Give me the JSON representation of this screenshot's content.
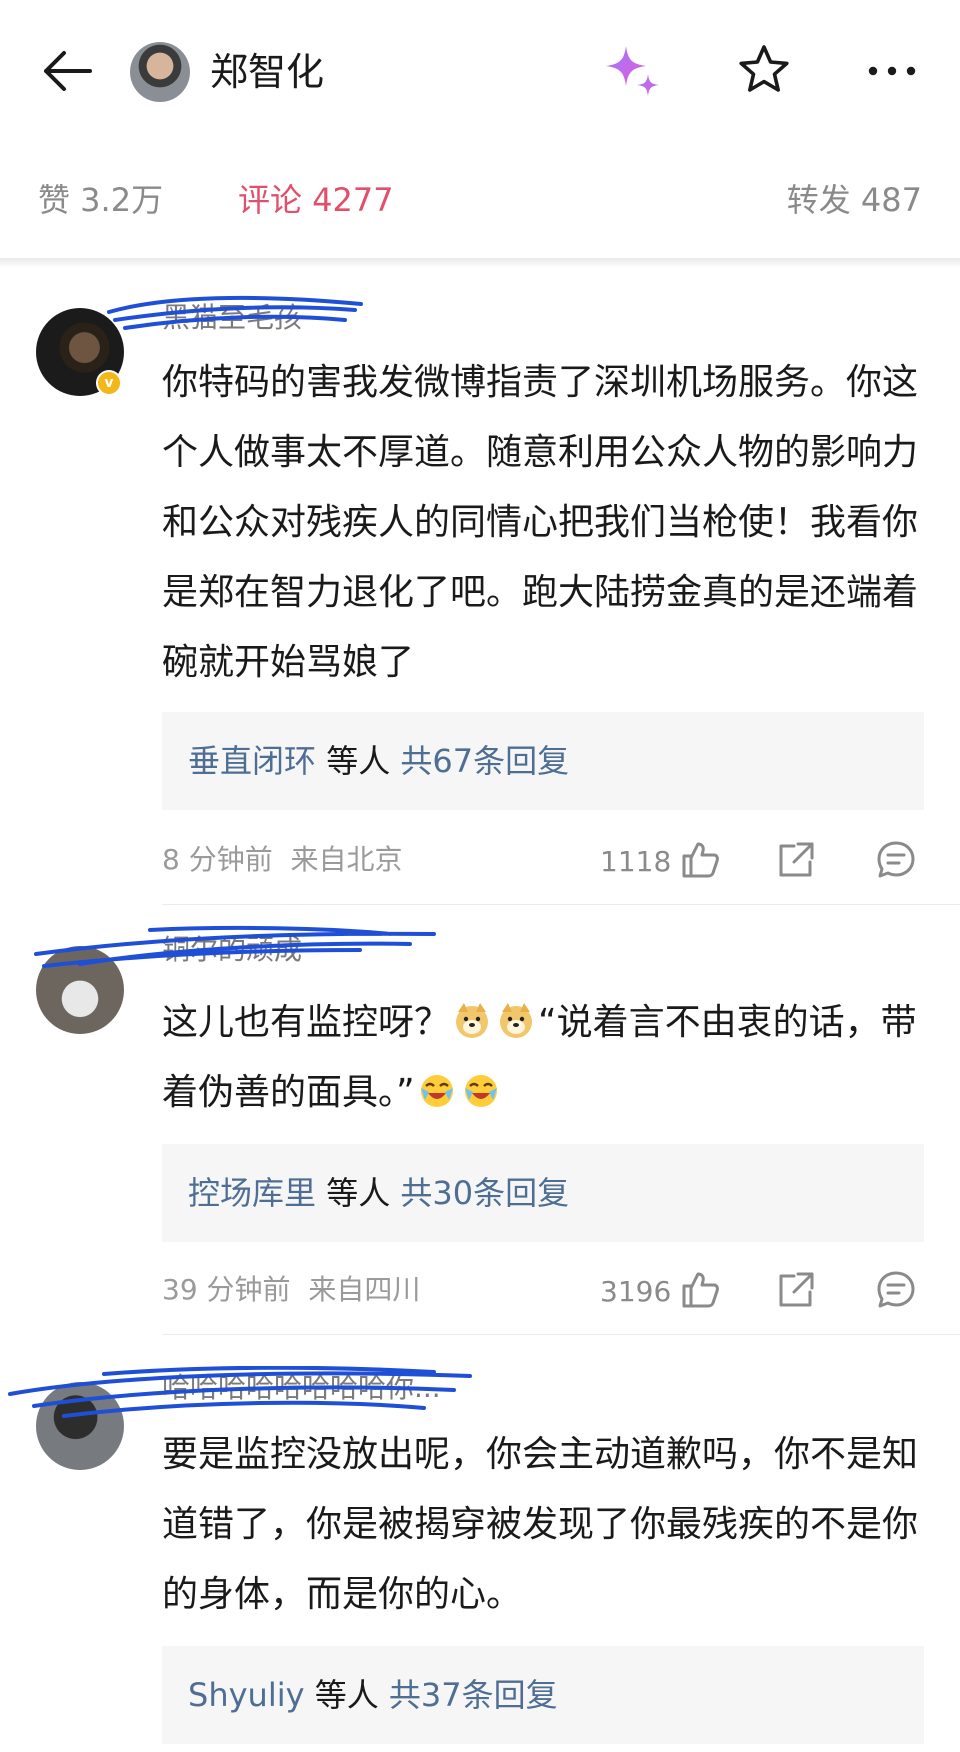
{
  "header": {
    "title": "郑智化"
  },
  "stats": {
    "likes": "赞 3.2万",
    "comments": "评论 4277",
    "reposts": "转发 487"
  },
  "comments": [
    {
      "username": "黑猫至毛孩",
      "text": "你特码的害我发微博指责了深圳机场服务。你这个人做事太不厚道。随意利用公众人物的影响力和公众对残疾人的同情心把我们当枪使！我看你是郑在智力退化了吧。跑大陆捞金真的是还端着碗就开始骂娘了",
      "reply_user": "垂直闭环",
      "reply_mid": " 等人 ",
      "reply_count": "共67条回复",
      "time": "8 分钟前",
      "location": "来自北京",
      "likes": "1118"
    },
    {
      "username": "铜尔的顽成",
      "text_part1": "这儿也有监控呀？",
      "text_part2": "“说着言不由衷的话，带着伪善的面具。”",
      "reply_user": "控场库里",
      "reply_mid": " 等人 ",
      "reply_count": "共30条回复",
      "time": "39 分钟前",
      "location": "来自四川",
      "likes": "3196"
    },
    {
      "username": "哈哈哈哈哈哈哈哈你...",
      "text": "要是监控没放出呢，你会主动道歉吗，你不是知道错了，你是被揭穿被发现了你最残疾的不是你的身体，而是你的心。",
      "reply_user": "Shyuliy",
      "reply_mid": " 等人 ",
      "reply_count": "共37条回复"
    }
  ],
  "colors": {
    "accent": "#e0506a",
    "link": "#4e6e94",
    "scribble": "#1f4fd6"
  },
  "icons": {
    "back": "arrow-left-icon",
    "sparkle": "sparkle-icon",
    "star": "star-icon",
    "more": "more-dots-icon",
    "like": "thumbs-up-icon",
    "share": "share-icon",
    "comment": "comment-icon"
  }
}
